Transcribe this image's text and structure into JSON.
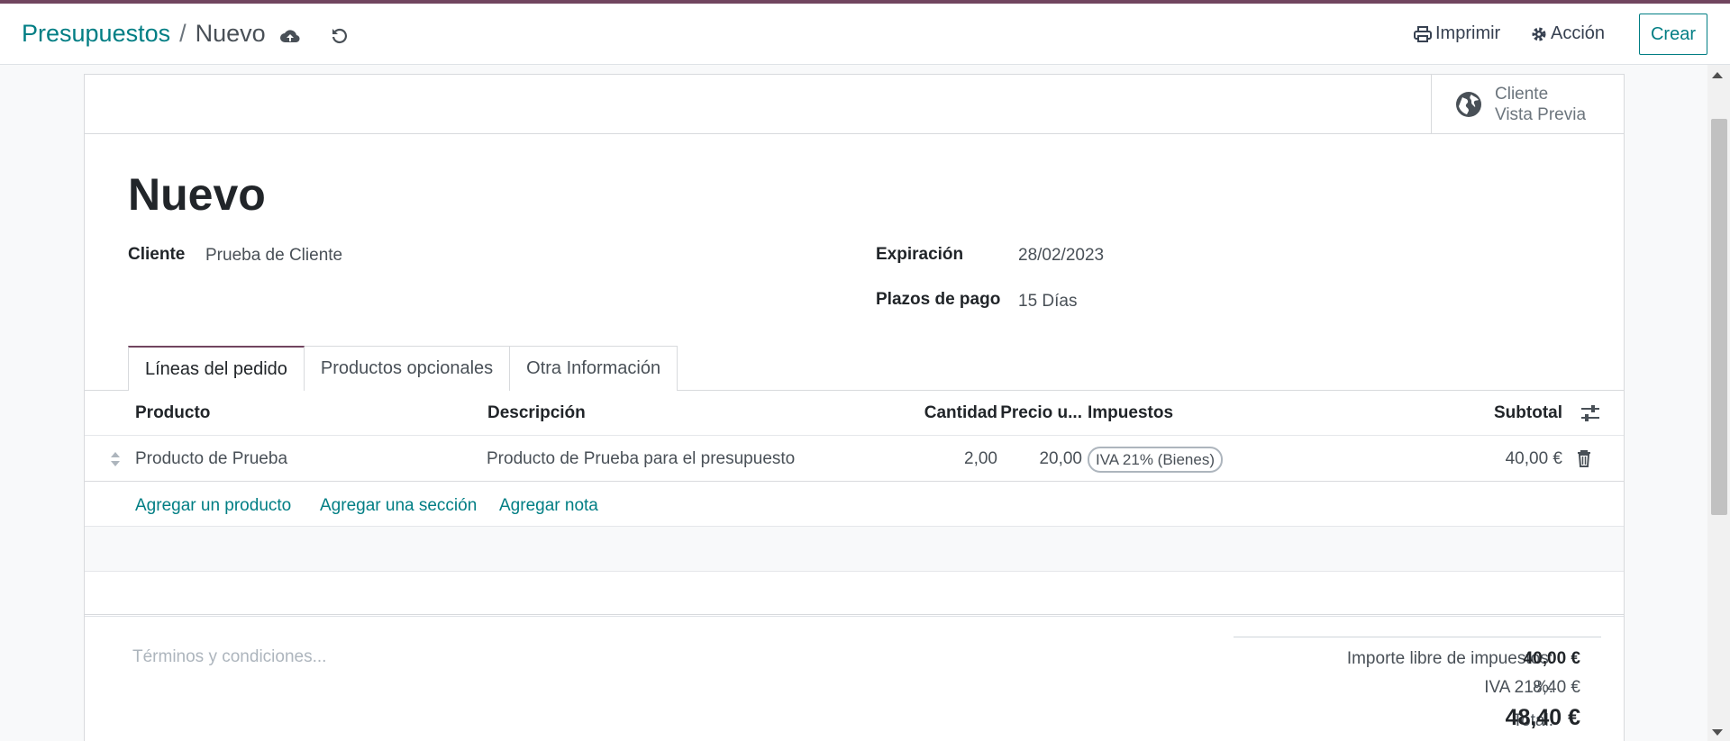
{
  "breadcrumb": {
    "parent": "Presupuestos",
    "separator": "/",
    "current": "Nuevo"
  },
  "actions": {
    "print": "Imprimir",
    "action": "Acción",
    "create": "Crear"
  },
  "smart_button": {
    "line1": "Cliente",
    "line2": "Vista Previa"
  },
  "form": {
    "title": "Nuevo",
    "customer_label": "Cliente",
    "customer_value": "Prueba de Cliente",
    "expiration_label": "Expiración",
    "expiration_value": "28/02/2023",
    "payment_terms_label": "Plazos de pago",
    "payment_terms_value": "15 Días"
  },
  "tabs": [
    "Líneas del pedido",
    "Productos opcionales",
    "Otra Información"
  ],
  "table": {
    "headers": {
      "product": "Producto",
      "description": "Descripción",
      "quantity": "Cantidad",
      "price": "Precio u...",
      "taxes": "Impuestos",
      "subtotal": "Subtotal"
    },
    "rows": [
      {
        "product": "Producto de Prueba",
        "description": "Producto de Prueba para el presupuesto",
        "quantity": "2,00",
        "price": "20,00",
        "tax": "IVA 21% (Bienes)",
        "subtotal": "40,00 €"
      }
    ],
    "add_links": [
      "Agregar un producto",
      "Agregar una sección",
      "Agregar nota"
    ]
  },
  "terms_placeholder": "Términos y condiciones...",
  "totals": {
    "untaxed_label": "Importe libre de impuestos:",
    "untaxed_value": "40,00 €",
    "tax_label": "IVA 21%:",
    "tax_value": "8,40 €",
    "total_label": "Total:",
    "total_value": "48,40 €"
  },
  "colors": {
    "brand": "#71455f",
    "link": "#017e84"
  }
}
